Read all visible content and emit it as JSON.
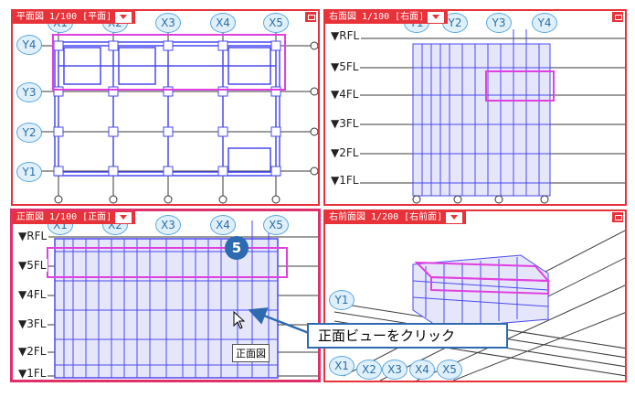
{
  "panes": {
    "plan": {
      "tab": "平面図 1/100 [平面]"
    },
    "right": {
      "tab": "右面図 1/100 [右面]"
    },
    "front": {
      "tab": "正面図 1/100 [正面]"
    },
    "persp": {
      "tab": "右前面図 1/200 [右前面]"
    }
  },
  "plan_axes": {
    "x": [
      "X1",
      "X2",
      "X3",
      "X4",
      "X5"
    ],
    "y": [
      "Y4",
      "Y3",
      "Y2",
      "Y1"
    ]
  },
  "right_axes": {
    "y": [
      "Y1",
      "Y2",
      "Y3",
      "Y4"
    ]
  },
  "front_axes": {
    "x": [
      "X1",
      "X2",
      "X3",
      "X4",
      "X5"
    ]
  },
  "persp_axes": {
    "x": [
      "X1",
      "X2",
      "X3",
      "X4",
      "X5"
    ],
    "y": [
      "Y1"
    ]
  },
  "levels": [
    "RFL",
    "5FL",
    "4FL",
    "3FL",
    "2FL",
    "1FL"
  ],
  "step_number": "5",
  "tooltip": "正面図",
  "callout": "正面ビューをクリック",
  "colors": {
    "frame": "#e8323a",
    "active": "#e0306a",
    "highlight": "#e040e0",
    "model": "#4a4af0",
    "callout": "#2e6ab0"
  }
}
